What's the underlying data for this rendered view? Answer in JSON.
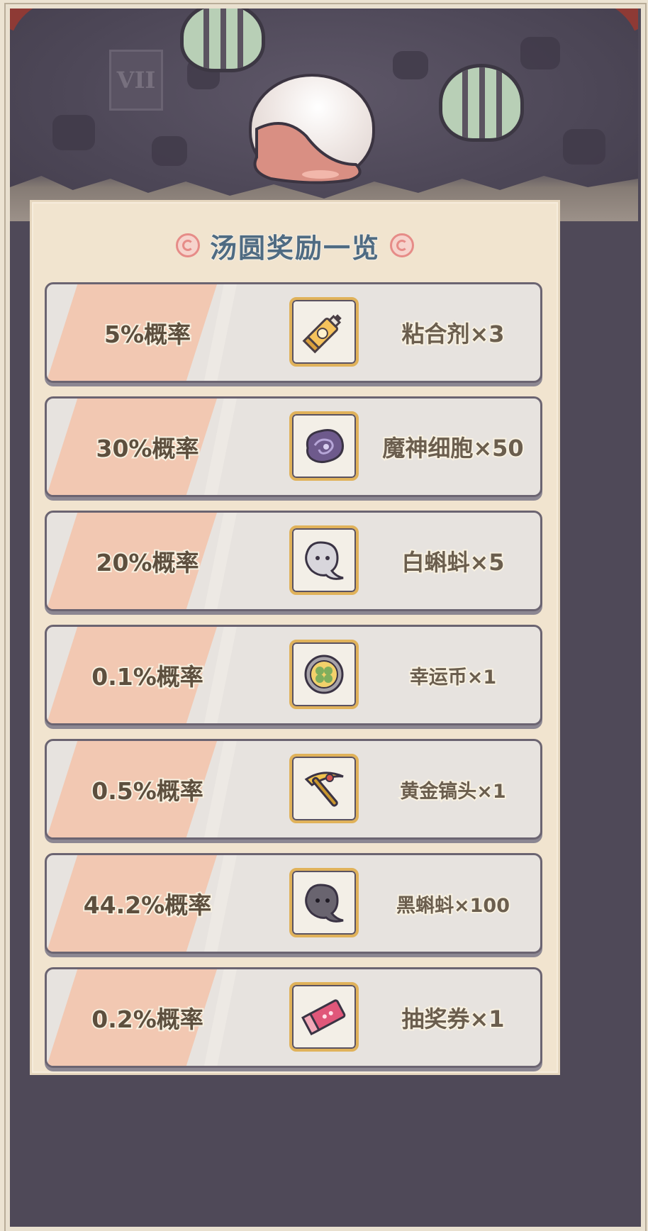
{
  "panel": {
    "title": "汤圆奖励一览"
  },
  "scene": {
    "plaque_text": "VII"
  },
  "rewards": [
    {
      "chance": "5%概率",
      "item": "粘合剂×3",
      "icon": "glue-tube-icon"
    },
    {
      "chance": "30%概率",
      "item": "魔神细胞×50",
      "icon": "demon-cell-icon"
    },
    {
      "chance": "20%概率",
      "item": "白蝌蚪×5",
      "icon": "white-tadpole-icon"
    },
    {
      "chance": "0.1%概率",
      "item": "幸运币×1",
      "icon": "lucky-coin-icon"
    },
    {
      "chance": "0.5%概率",
      "item": "黄金镐头×1",
      "icon": "golden-pickaxe-icon"
    },
    {
      "chance": "44.2%概率",
      "item": "黑蝌蚪×100",
      "icon": "black-tadpole-icon"
    },
    {
      "chance": "0.2%概率",
      "item": "抽奖券×1",
      "icon": "lottery-ticket-icon"
    }
  ],
  "colors": {
    "title": "#4f6b82",
    "row_stripe": "#f2c8b2",
    "icon_border": "#e0b25a",
    "frame": "#4f4958",
    "panel": "#f1e4cf"
  }
}
